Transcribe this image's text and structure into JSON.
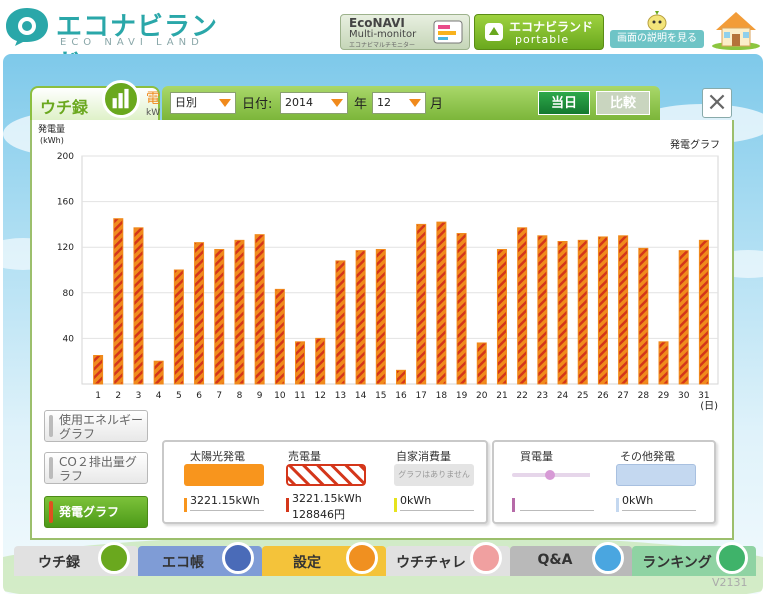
{
  "header": {
    "logo_title": "エコナビランド",
    "logo_subtitle": "ECO NAVI LAND",
    "econavi_btn": {
      "line1": "EcoNAVI",
      "line2": "Multi-monitor",
      "line3": "エコナビマルチモニター"
    },
    "portable_btn": {
      "line1": "エコナビランド",
      "line2": "portable"
    },
    "help_btn": "画面の説明を見る"
  },
  "panel": {
    "tab_label": "ウチ録",
    "tab_unit": "kW",
    "tab_icon_char": "電",
    "toolbar": {
      "period": "日別",
      "date_label": "日付:",
      "year": "2014",
      "year_label": "年",
      "month": "12",
      "month_label": "月",
      "today_btn": "当日",
      "compare_btn": "比較"
    },
    "close_icon": "×"
  },
  "chart_data": {
    "type": "bar",
    "title": "発電グラフ",
    "ylabel": "発電量",
    "yunit": "(kWh)",
    "xlabel": "(日)",
    "ylim": [
      0,
      200
    ],
    "yticks": [
      40,
      80,
      120,
      160,
      200
    ],
    "categories": [
      "1",
      "2",
      "3",
      "4",
      "5",
      "6",
      "7",
      "8",
      "9",
      "10",
      "11",
      "12",
      "13",
      "14",
      "15",
      "16",
      "17",
      "18",
      "19",
      "20",
      "21",
      "22",
      "23",
      "24",
      "25",
      "26",
      "27",
      "28",
      "29",
      "30",
      "31"
    ],
    "values": [
      25,
      145,
      137,
      20,
      100,
      124,
      118,
      126,
      131,
      83,
      37,
      40,
      108,
      117,
      118,
      12,
      140,
      142,
      132,
      36,
      118,
      137,
      130,
      125,
      126,
      129,
      130,
      119,
      37,
      117,
      126
    ],
    "bar_color": "#f08a1c",
    "hatch_color": "#d4361a",
    "grid": true
  },
  "side_nav": [
    {
      "label": "使用エネルギーグラフ"
    },
    {
      "label": "CO２排出量グラフ"
    },
    {
      "label": "発電グラフ"
    }
  ],
  "legend": {
    "solar": {
      "title": "太陽光発電",
      "value": "3221.15kWh",
      "color": "#f8951d"
    },
    "sold": {
      "title": "売電量",
      "value": "3221.15kWh",
      "value2": "128846円"
    },
    "self": {
      "title": "自家消費量",
      "na": "グラフはありません",
      "value": "0kWh"
    },
    "buy": {
      "title": "買電量",
      "value": ""
    },
    "other": {
      "title": "その他発電",
      "value": "0kWh",
      "color": "#c4d8f0"
    }
  },
  "bottom_nav": [
    {
      "label": "ウチ録"
    },
    {
      "label": "エコ帳"
    },
    {
      "label": "設定"
    },
    {
      "label": "ウチチャレ"
    },
    {
      "label": "Q&A"
    },
    {
      "label": "ランキング"
    }
  ],
  "version": "V2131"
}
